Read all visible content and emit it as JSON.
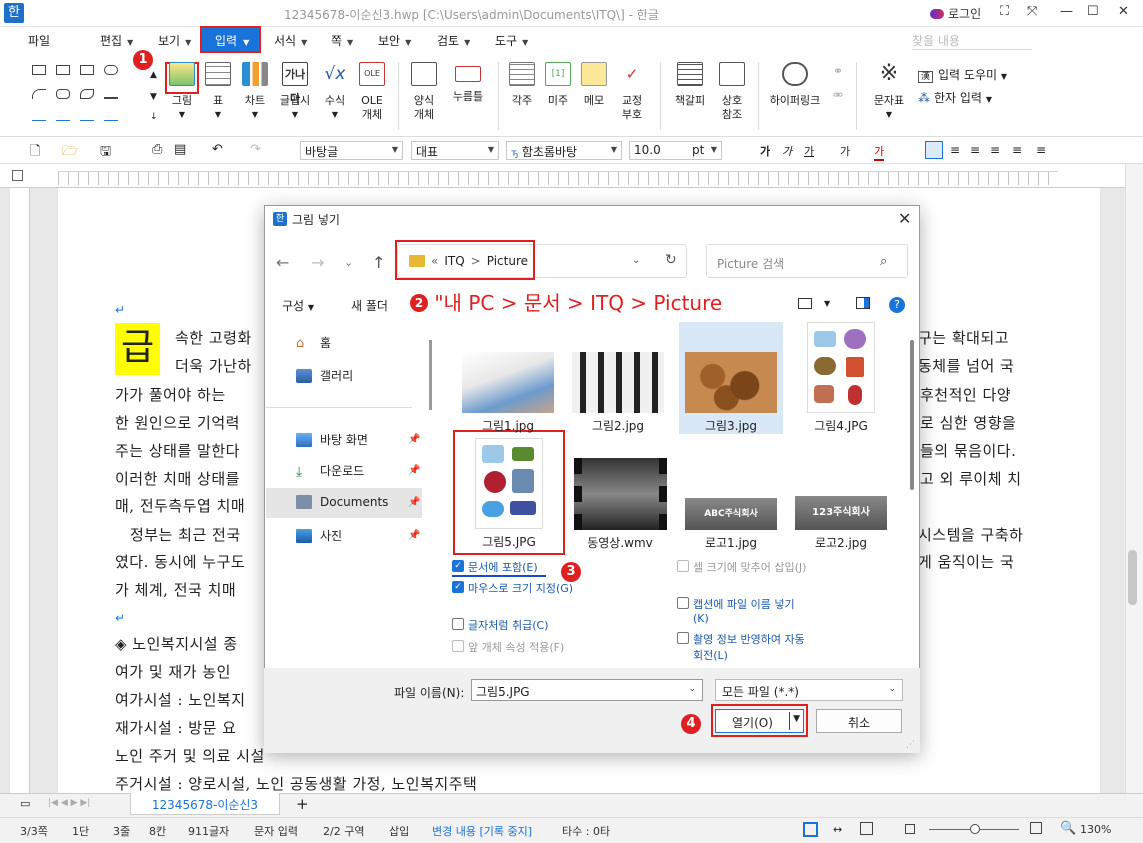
{
  "window": {
    "title": "12345678-이순신3.hwp [C:\\Users\\admin\\Documents\\ITQ\\] - 한글",
    "app_icon": "한",
    "login": "로그인"
  },
  "menus": [
    "파일",
    "편집",
    "보기",
    "입력",
    "서식",
    "쪽",
    "보안",
    "검토",
    "도구"
  ],
  "menu_search_placeholder": "찾을 내용",
  "ribbon": {
    "buttons": [
      "그림",
      "표",
      "차트",
      "글맵시",
      "수식",
      "OLE 개체",
      "양식 개체",
      "누름틀",
      "각주",
      "미주",
      "메모",
      "교정 부호",
      "책갈피",
      "상호 참조",
      "하이퍼링크",
      "문자표"
    ],
    "right_items": [
      "입력 도우미",
      "한자 입력"
    ]
  },
  "format_toolbar": {
    "style": "바탕글",
    "represent": "대표",
    "font": "함초롬바탕",
    "size": "10.0",
    "unit": "pt"
  },
  "document": {
    "big_char": "급",
    "lines_left": [
      "속한 고령화",
      "더욱 가난하",
      "가가 풀어야 하는",
      "한 원인으로 기억력",
      "주는 상태를 말한다",
      "이러한 치매 상태를",
      "매, 전두측두엽 치매",
      "정부는 최근 전국",
      "였다. 동시에 누구도",
      "가 체계, 전국 치매",
      "◈ 노인복지시설 종",
      "여가 및 재가 농인",
      "여가시설 : 노인복지",
      "재가시설 : 방문 요",
      "노인 주거 및 의료 시설",
      "주거시설 : 양로시설, 노인 공동생활 가정, 노인복지주택"
    ],
    "lines_right": [
      "구는 확대되고",
      "동체를 넘어 국",
      "후천적인 다양",
      "로 심한 영향을",
      "들의 묶음이다.",
      "고 외 루이체 치",
      "시스템을 구축하",
      "게 움직이는 국"
    ]
  },
  "doc_tab": "12345678-이순신3",
  "status": [
    "3/3쪽",
    "1단",
    "3줄",
    "8칸",
    "911글자",
    "문자 입력",
    "2/2 구역",
    "삽입",
    "변경 내용 [기록 중지]",
    "타수 : 0타",
    "130%"
  ],
  "dialog": {
    "title": "그림 넣기",
    "breadcrumb": [
      "«",
      "ITQ",
      ">",
      "Picture"
    ],
    "search_placeholder": "Picture 검색",
    "organize": "구성",
    "new_folder": "새 폴더",
    "annotation_path": "\"내 PC > 문서 > ITQ > Picture",
    "nav": [
      {
        "label": "홈",
        "icon": "home-icon"
      },
      {
        "label": "갤러리",
        "icon": "gallery-icon"
      },
      {
        "label": "바탕 화면",
        "icon": "desktop-icon"
      },
      {
        "label": "다운로드",
        "icon": "download-icon"
      },
      {
        "label": "Documents",
        "icon": "documents-icon"
      },
      {
        "label": "사진",
        "icon": "pictures-icon"
      }
    ],
    "files": [
      "그림1.jpg",
      "그림2.jpg",
      "그림3.jpg",
      "그림4.JPG",
      "그림5.JPG",
      "동영상.wmv",
      "로고1.jpg",
      "로고2.jpg"
    ],
    "logo1_text": "ABC주식회사",
    "logo2_text": "123주식회사",
    "options_left": [
      {
        "label": "문서에 포함(E)",
        "checked": true,
        "disabled": false
      },
      {
        "label": "마우스로 크기 지정(G)",
        "checked": true,
        "disabled": false
      },
      {
        "label": "글자처럼 취급(C)",
        "checked": false,
        "disabled": false
      },
      {
        "label": "앞 개체 속성 적용(F)",
        "checked": false,
        "disabled": true
      }
    ],
    "options_right": [
      {
        "label": "셀 크기에 맞추어 삽입(J)",
        "checked": false,
        "disabled": true
      },
      {
        "label": "캡션에 파일 이름 넣기(K)",
        "checked": false,
        "disabled": false
      },
      {
        "label": "촬영 정보 반영하여 자동 회전(L)",
        "checked": false,
        "disabled": false
      }
    ],
    "filename_label": "파일 이름(N):",
    "filename": "그림5.JPG",
    "filetype": "모든 파일 (*.*)",
    "open": "열기(O)",
    "cancel": "취소"
  },
  "annotations": [
    "1",
    "2",
    "3",
    "4"
  ],
  "colors": {
    "accent": "#1a73d9",
    "highlight": "#e02020",
    "yellow": "#ffff00"
  }
}
